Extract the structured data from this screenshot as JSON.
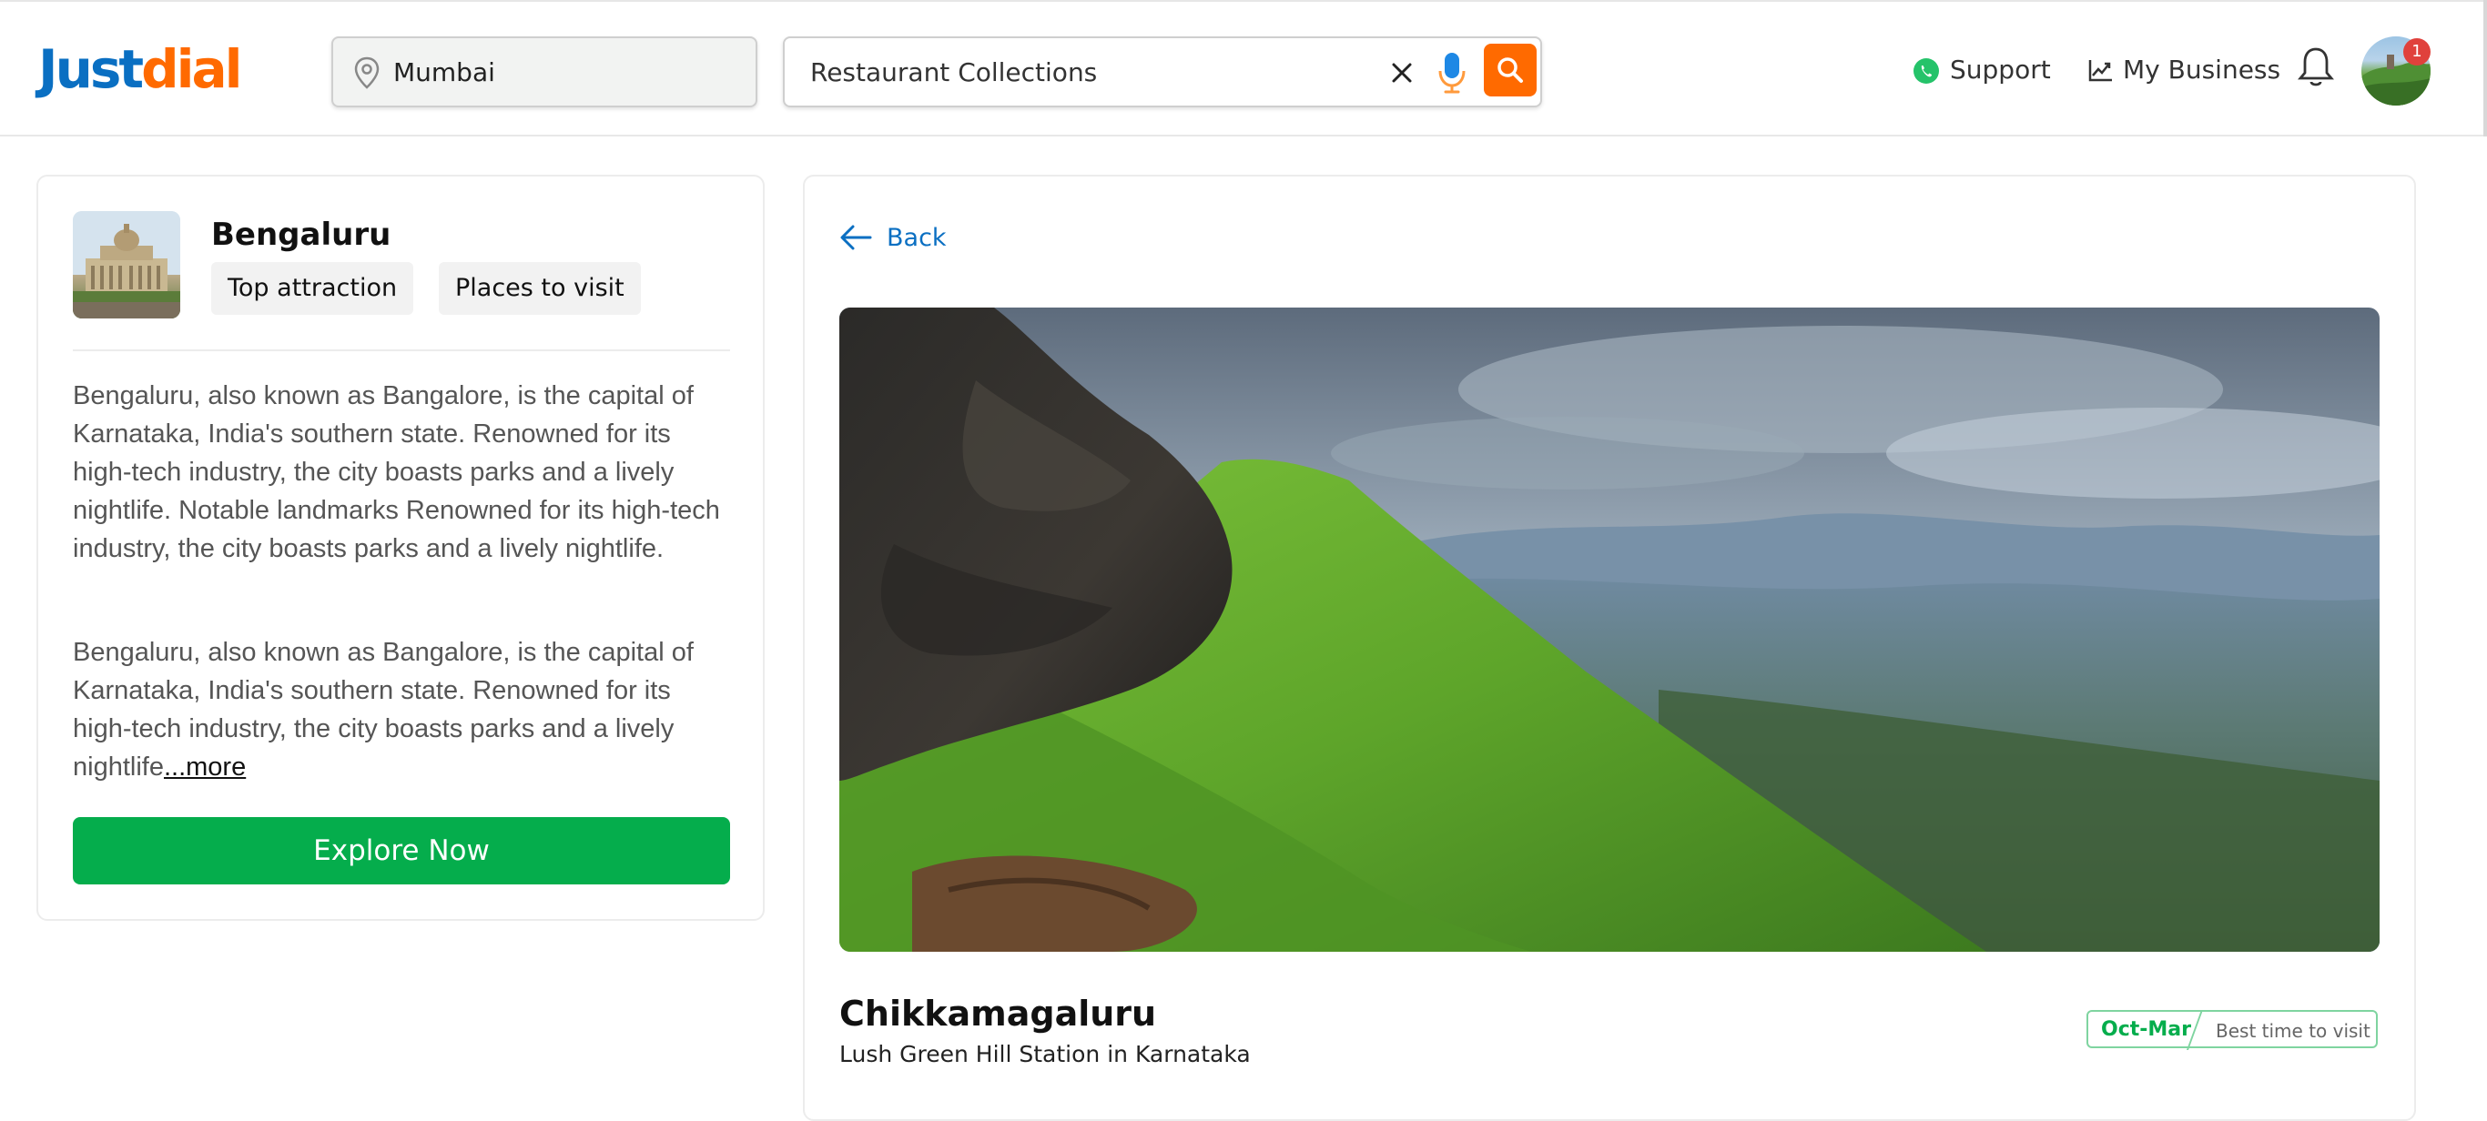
{
  "header": {
    "logo": {
      "part1": "Just",
      "part2": "dial"
    },
    "location": "Mumbai",
    "search_query": "Restaurant Collections",
    "support_label": "Support",
    "business_label": "My Business",
    "notification_badge": "1"
  },
  "city": {
    "name": "Bengaluru",
    "chips": [
      "Top attraction",
      "Places to visit"
    ],
    "description_1": "Bengaluru, also known as Bangalore, is the capital of Karnataka, India's southern state. Renowned for its high-tech industry, the city boasts parks and a lively nightlife. Notable landmarks Renowned for its high-tech industry, the city boasts parks and a lively nightlife.",
    "description_2": "Bengaluru, also known as Bangalore, is the capital of Karnataka, India's southern state. Renowned for its high-tech industry, the city boasts parks and a lively nightlife",
    "more_label": "...more",
    "explore_label": "Explore Now"
  },
  "detail": {
    "back_label": "Back",
    "place_title": "Chikkamagaluru",
    "place_subtitle": "Lush Green Hill Station in Karnataka",
    "best_time_value": "Oct-Mar",
    "best_time_label": "Best time to visit"
  },
  "colors": {
    "brand_blue": "#0a6fc2",
    "brand_orange": "#ff6a00",
    "green": "#05ad4c"
  }
}
